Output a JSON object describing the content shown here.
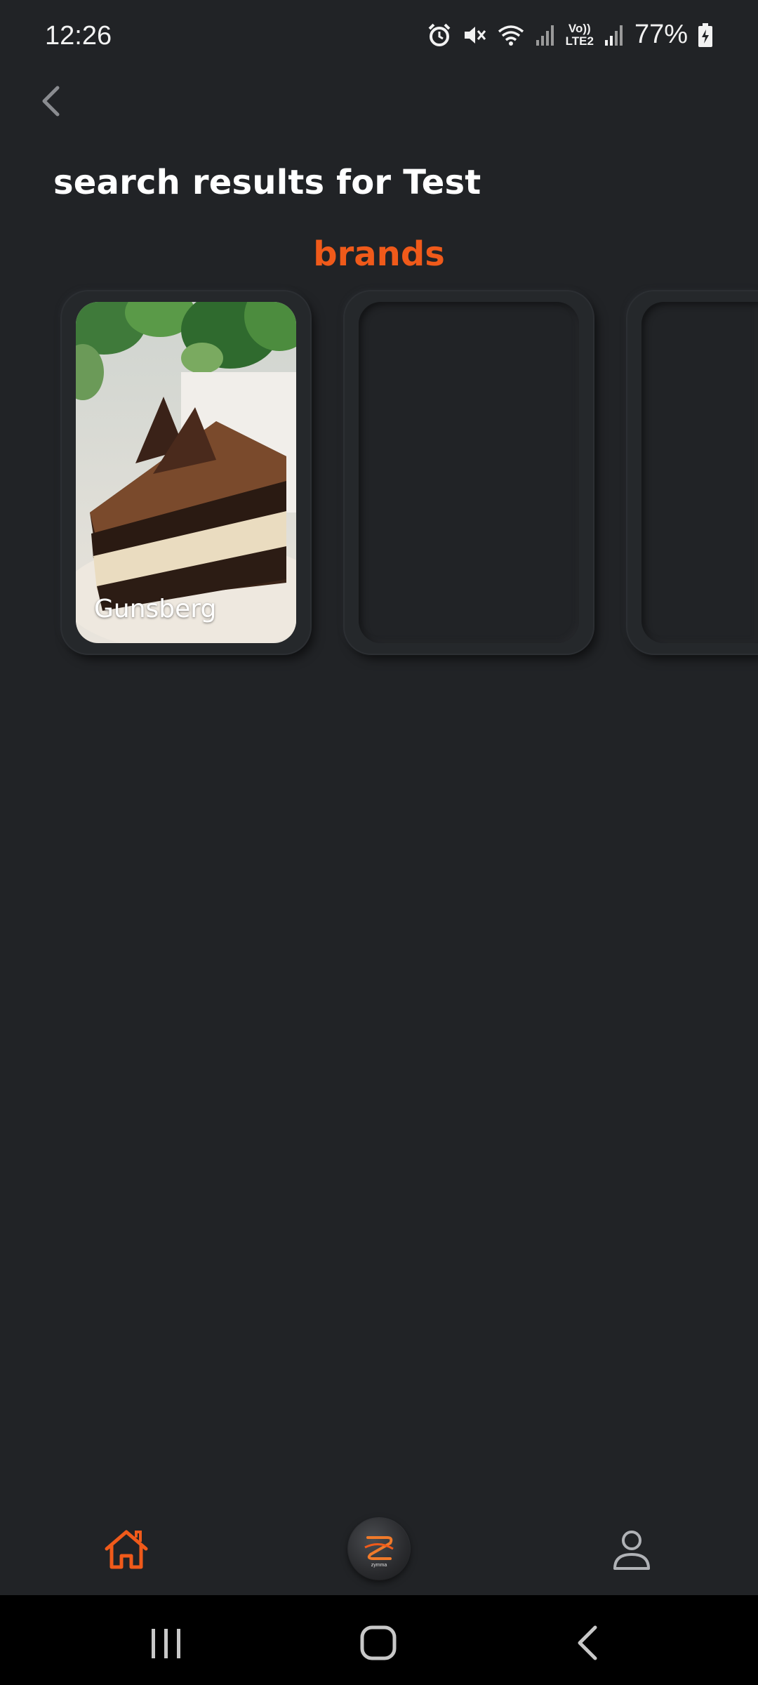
{
  "status_bar": {
    "time": "12:26",
    "network_label_top": "Vo))",
    "network_label_bottom": "LTE2",
    "battery": "77%"
  },
  "page": {
    "title": "search results for Test",
    "section_title": "brands"
  },
  "brands": [
    {
      "name": "Gunsberg",
      "image": "chocolate-cake-slice"
    },
    {
      "name": ""
    },
    {
      "name": ""
    }
  ],
  "bottom_nav": {
    "home_icon": "home-icon",
    "center_icon": "app-logo-icon",
    "center_logo_text": "zymma",
    "profile_icon": "person-icon"
  },
  "colors": {
    "background": "#212326",
    "accent": "#f05a1a",
    "text": "#ffffff"
  }
}
